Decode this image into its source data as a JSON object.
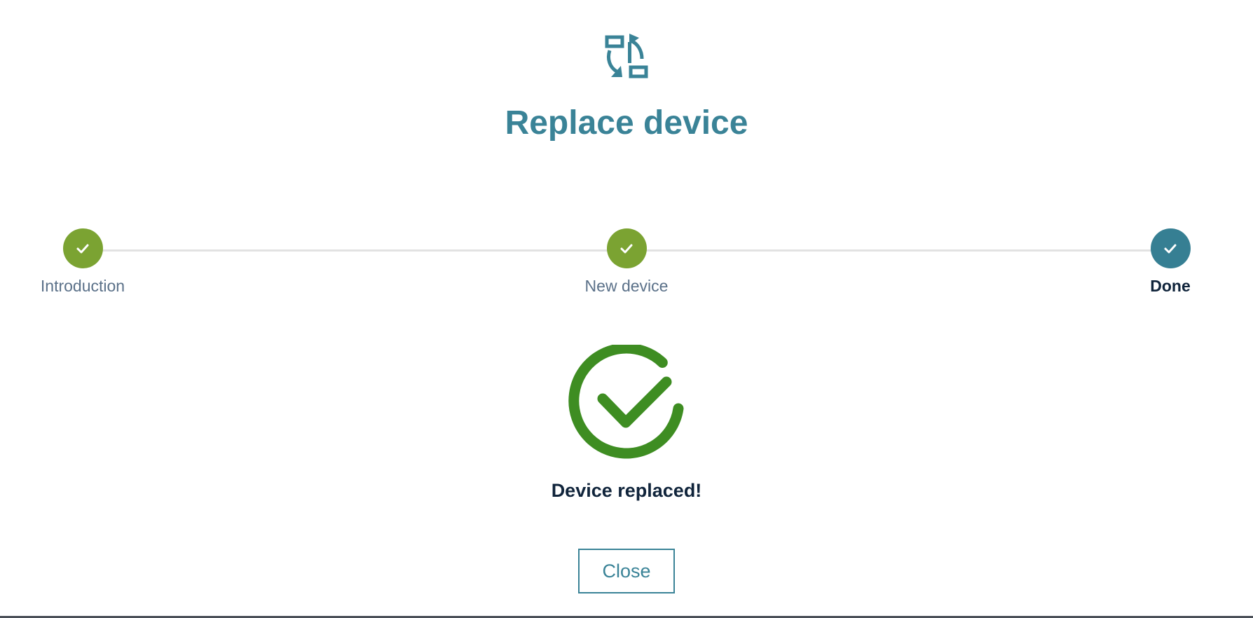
{
  "dialog": {
    "title": "Replace device",
    "header_icon": "replace-arrows-icon"
  },
  "stepper": {
    "steps": [
      {
        "label": "Introduction",
        "state": "completed",
        "icon": "check-icon"
      },
      {
        "label": "New device",
        "state": "completed",
        "icon": "check-icon"
      },
      {
        "label": "Done",
        "state": "current",
        "icon": "check-icon"
      }
    ]
  },
  "result": {
    "icon": "success-check-circle-icon",
    "message": "Device replaced!"
  },
  "actions": {
    "close_label": "Close"
  },
  "colors": {
    "accent": "#3a8397",
    "completed_step": "#7ba332",
    "current_step": "#367f93",
    "success": "#3e8d22",
    "heading_text": "#10243b",
    "muted_text": "#5b7189"
  }
}
